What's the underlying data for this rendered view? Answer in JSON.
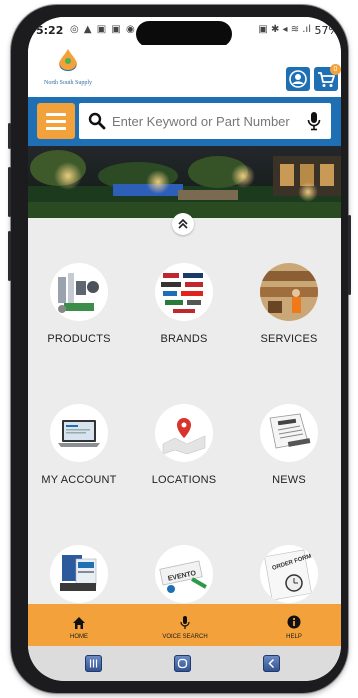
{
  "status_bar": {
    "time": "5:22",
    "battery": "57%"
  },
  "header": {
    "logo_text": "North South Supply",
    "cart_count": "0"
  },
  "search": {
    "placeholder": "Enter Keyword or Part Number"
  },
  "tiles": [
    {
      "label": "PRODUCTS",
      "icon": "products-image"
    },
    {
      "label": "BRANDS",
      "icon": "brands-image"
    },
    {
      "label": "SERVICES",
      "icon": "services-image"
    },
    {
      "label": "MY ACCOUNT",
      "icon": "laptop-image"
    },
    {
      "label": "LOCATIONS",
      "icon": "map-pin-image"
    },
    {
      "label": "NEWS",
      "icon": "newspaper-image"
    },
    {
      "label": "",
      "icon": "catalog-image"
    },
    {
      "label": "",
      "icon": "events-image"
    },
    {
      "label": "",
      "icon": "order-form-image"
    }
  ],
  "bottom_nav": {
    "home": "HOME",
    "voice": "VOICE SEARCH",
    "help": "HELP"
  },
  "colors": {
    "brand_blue": "#1f6fb5",
    "accent_orange": "#f3a13a",
    "background": "#ececec"
  }
}
